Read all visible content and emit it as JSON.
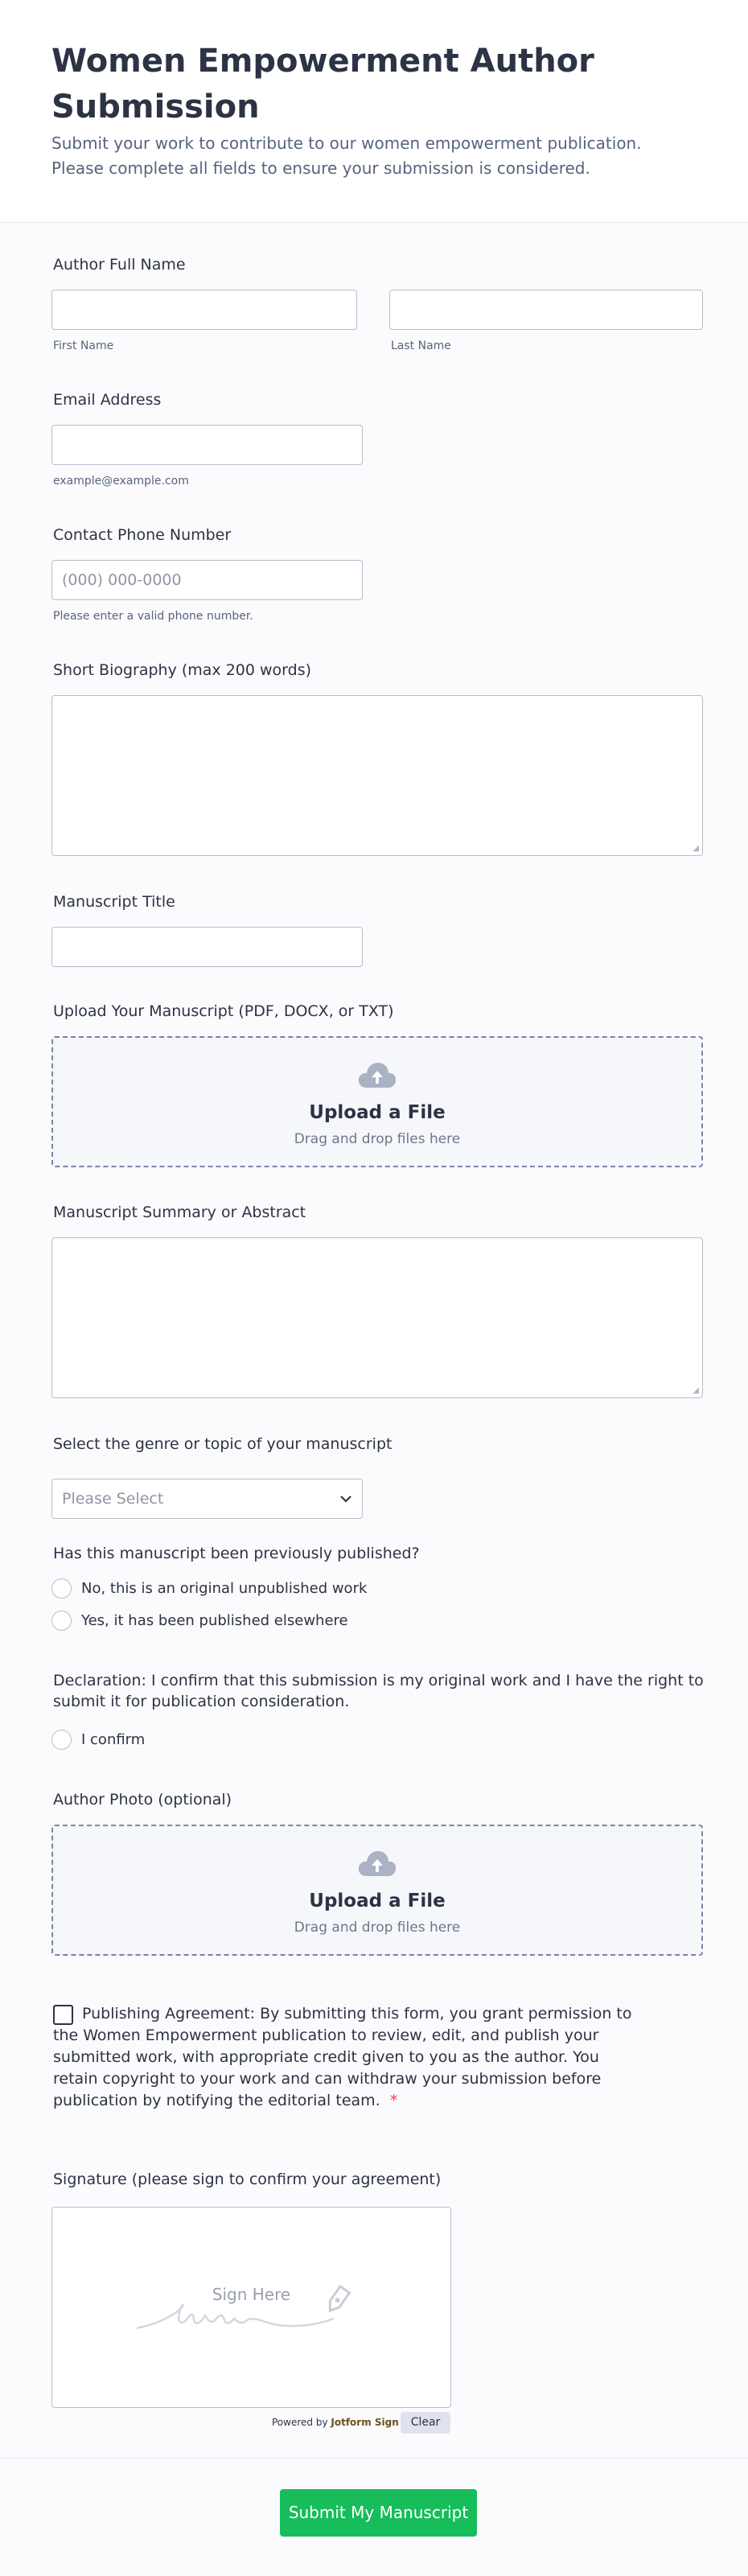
{
  "form": {
    "title": "Women Empowerment Author Submission",
    "subtitle": "Submit your work to contribute to our women empowerment publication. Please complete all fields to ensure your submission is considered."
  },
  "author_name": {
    "label": "Author Full Name",
    "first_sublabel": "First Name",
    "last_sublabel": "Last Name",
    "first_value": "",
    "last_value": ""
  },
  "email": {
    "label": "Email Address",
    "sublabel": "example@example.com",
    "value": ""
  },
  "phone": {
    "label": "Contact Phone Number",
    "placeholder": "(000) 000-0000",
    "sublabel": "Please enter a valid phone number."
  },
  "biography": {
    "label": "Short Biography (max 200 words)",
    "value": ""
  },
  "manuscript_title": {
    "label": "Manuscript Title",
    "value": ""
  },
  "manuscript_upload": {
    "label": "Upload Your Manuscript (PDF, DOCX, or TXT)",
    "button_label": "Upload a File",
    "hint": "Drag and drop files here",
    "icon": "cloud-upload-icon"
  },
  "summary": {
    "label": "Manuscript Summary or Abstract",
    "value": ""
  },
  "genre": {
    "label": "Select the genre or topic of your manuscript",
    "selected": "Please Select",
    "icon": "chevron-down-icon"
  },
  "published": {
    "label": "Has this manuscript been previously published?",
    "options": [
      "No, this is an original unpublished work",
      "Yes, it has been published elsewhere"
    ]
  },
  "declaration": {
    "label": "Declaration: I confirm that this submission is my original work and I have the right to submit it for publication consideration.",
    "option": "I confirm"
  },
  "author_photo": {
    "label": "Author Photo (optional)",
    "button_label": "Upload a File",
    "hint": "Drag and drop files here",
    "icon": "cloud-upload-icon"
  },
  "agreement": {
    "text": "Publishing Agreement: By submitting this form, you grant permission to the Women Empowerment publication to review, edit, and publish your submitted work, with appropriate credit given to you as the author. You retain copyright to your work and can withdraw your submission before publication by notifying the editorial team.",
    "required_mark": "*"
  },
  "signature": {
    "label": "Signature (please sign to confirm your agreement)",
    "placeholder": "Sign Here",
    "powered_by": "Powered by",
    "brand": "Jotform Sign",
    "clear_label": "Clear"
  },
  "submit": {
    "label": "Submit My Manuscript"
  },
  "colors": {
    "accent_green": "#18bd5b",
    "text_primary": "#2c3345",
    "text_secondary": "#57647e",
    "required_red": "#f23a3c",
    "border": "#b8bdc9"
  }
}
